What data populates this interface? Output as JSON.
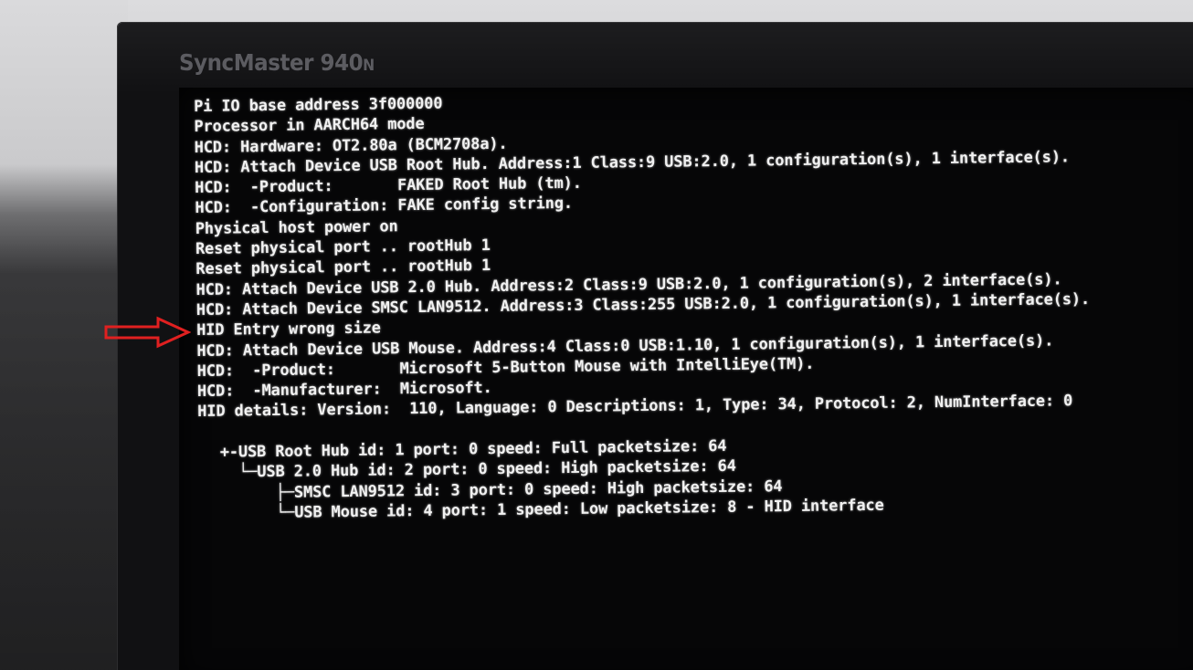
{
  "monitor": {
    "brand": "SyncMaster 940",
    "brand_suffix": "N"
  },
  "terminal": {
    "lines": [
      "Pi IO base address 3f000000",
      "Processor in AARCH64 mode",
      "HCD: Hardware: OT2.80a (BCM2708a).",
      "HCD: Attach Device USB Root Hub. Address:1 Class:9 USB:2.0, 1 configuration(s), 1 interface(s).",
      "HCD:  -Product:       FAKED Root Hub (tm).",
      "HCD:  -Configuration: FAKE config string.",
      "Physical host power on",
      "Reset physical port .. rootHub 1",
      "Reset physical port .. rootHub 1",
      "HCD: Attach Device USB 2.0 Hub. Address:2 Class:9 USB:2.0, 1 configuration(s), 2 interface(s).",
      "HCD: Attach Device SMSC LAN9512. Address:3 Class:255 USB:2.0, 1 configuration(s), 1 interface(s).",
      "HID Entry wrong size",
      "HCD: Attach Device USB Mouse. Address:4 Class:0 USB:1.10, 1 configuration(s), 1 interface(s).",
      "HCD:  -Product:       Microsoft 5-Button Mouse with IntelliEye(TM).",
      "HCD:  -Manufacturer:  Microsoft.",
      "HID details: Version:  110, Language: 0 Descriptions: 1, Type: 34, Protocol: 2, NumInterface: 0"
    ],
    "device_tree": [
      "+-USB Root Hub id: 1 port: 0 speed: Full packetsize: 64",
      "  └─USB 2.0 Hub id: 2 port: 0 speed: High packetsize: 64",
      "      ├─SMSC LAN9512 id: 3 port: 0 speed: High packetsize: 64",
      "      └─USB Mouse id: 4 port: 1 speed: Low packetsize: 8 - HID interface"
    ]
  },
  "annotation": {
    "icon": "right-arrow-outline",
    "color": "#e02020",
    "points_to_line": 11
  }
}
